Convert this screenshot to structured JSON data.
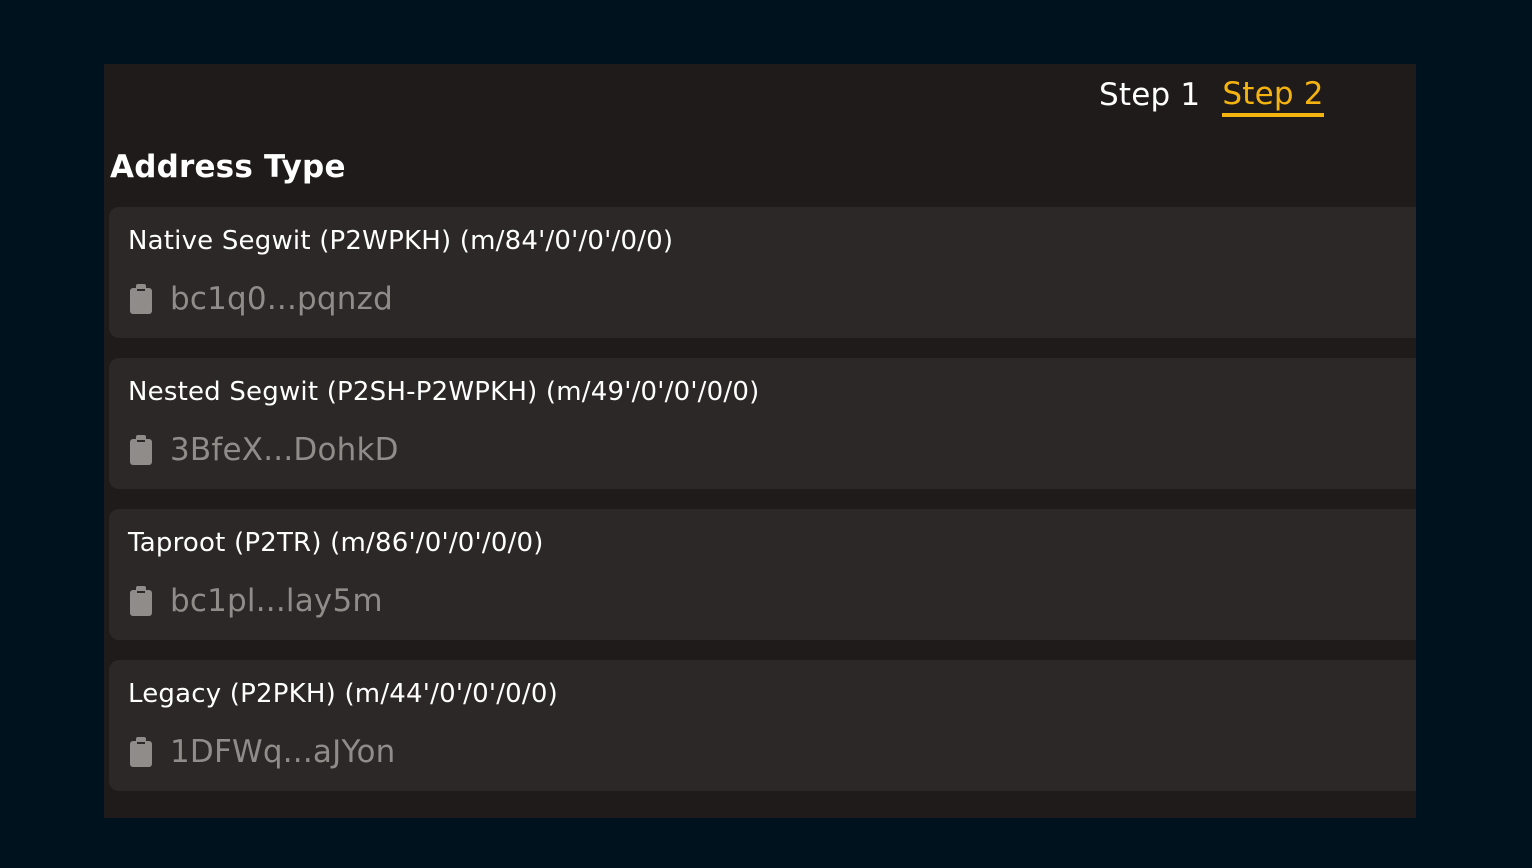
{
  "steps": [
    {
      "label": "Step 1",
      "active": false
    },
    {
      "label": "Step 2",
      "active": true
    }
  ],
  "section_title": "Address Type",
  "address_types": [
    {
      "title": "Native Segwit (P2WPKH) (m/84'/0'/0'/0/0)",
      "address": "bc1q0...pqnzd",
      "icon": "clipboard-icon"
    },
    {
      "title": "Nested Segwit (P2SH-P2WPKH) (m/49'/0'/0'/0/0)",
      "address": "3BfeX...DohkD",
      "icon": "clipboard-icon"
    },
    {
      "title": "Taproot (P2TR) (m/86'/0'/0'/0/0)",
      "address": "bc1pl...lay5m",
      "icon": "clipboard-icon"
    },
    {
      "title": "Legacy (P2PKH) (m/44'/0'/0'/0/0)",
      "address": "1DFWq...aJYon",
      "icon": "clipboard-icon"
    }
  ],
  "colors": {
    "background": "#01121f",
    "panel": "#1f1b1a",
    "card": "#2b2827",
    "accent": "#f5b30f",
    "text": "#ffffff",
    "muted": "#8f8c8a"
  }
}
